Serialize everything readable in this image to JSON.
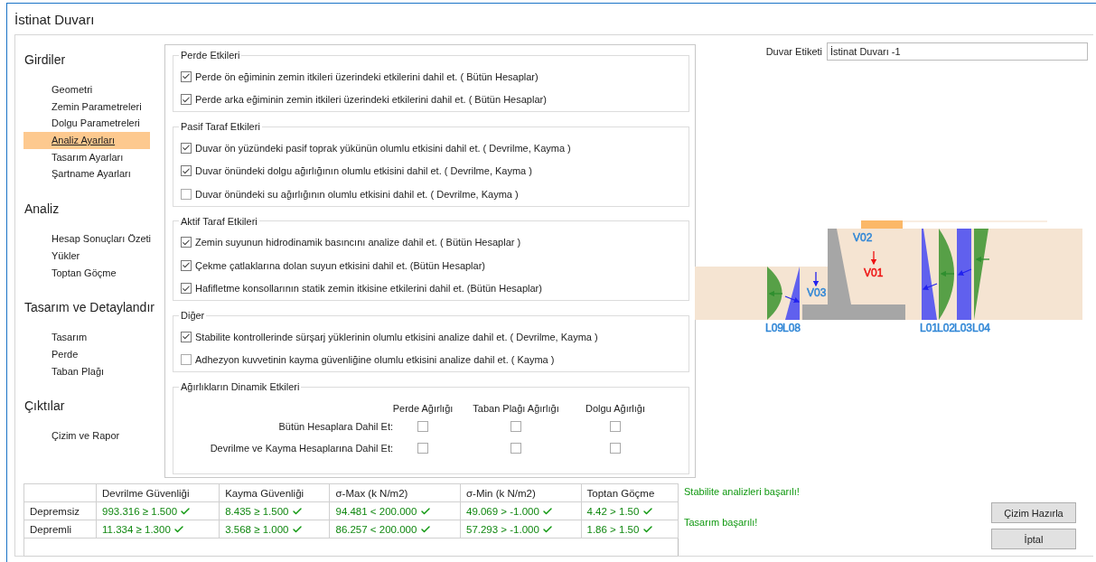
{
  "window": {
    "title": "İstinat Duvarı"
  },
  "sidebar": {
    "sections": [
      {
        "heading": "Girdiler",
        "items": [
          {
            "label": "Geometri",
            "selected": false
          },
          {
            "label": "Zemin Parametreleri",
            "selected": false
          },
          {
            "label": "Dolgu Parametreleri",
            "selected": false
          },
          {
            "label": "Analiz Ayarları",
            "selected": true
          },
          {
            "label": "Tasarım Ayarları",
            "selected": false
          },
          {
            "label": "Şartname Ayarları",
            "selected": false
          }
        ]
      },
      {
        "heading": "Analiz",
        "items": [
          {
            "label": "Hesap Sonuçları Özeti",
            "selected": false
          },
          {
            "label": "Yükler",
            "selected": false
          },
          {
            "label": "Toptan Göçme",
            "selected": false
          }
        ]
      },
      {
        "heading": "Tasarım ve Detaylandır",
        "items": [
          {
            "label": "Tasarım",
            "selected": false
          },
          {
            "label": "Perde",
            "selected": false
          },
          {
            "label": "Taban Plağı",
            "selected": false
          }
        ]
      },
      {
        "heading": "Çıktılar",
        "items": [
          {
            "label": "Çizim ve Rapor",
            "selected": false
          }
        ]
      }
    ]
  },
  "settings": {
    "groups": [
      {
        "legend": "Perde Etkileri",
        "options": [
          {
            "label": "Perde ön eğiminin zemin itkileri üzerindeki etkilerini dahil et. ( Bütün Hesaplar)",
            "checked": true
          },
          {
            "label": "Perde arka eğiminin zemin itkileri üzerindeki etkilerini dahil et. ( Bütün Hesaplar)",
            "checked": true
          }
        ]
      },
      {
        "legend": "Pasif Taraf Etkileri",
        "options": [
          {
            "label": "Duvar ön yüzündeki pasif toprak yükünün olumlu etkisini dahil et. ( Devrilme, Kayma )",
            "checked": true
          },
          {
            "label": "Duvar önündeki dolgu ağırlığının olumlu etkisini dahil et.  ( Devrilme, Kayma )",
            "checked": true
          },
          {
            "label": "Duvar önündeki su ağırlığının olumlu etkisini dahil et. ( Devrilme, Kayma )",
            "checked": false
          }
        ]
      },
      {
        "legend": "Aktif Taraf Etkileri",
        "options": [
          {
            "label": "Zemin suyunun hidrodinamik basıncını analize dahil et. ( Bütün Hesaplar )",
            "checked": true
          },
          {
            "label": "Çekme çatlaklarına dolan suyun etkisini dahil et. (Bütün Hesaplar)",
            "checked": true
          },
          {
            "label": "Hafifletme konsollarının statik zemin itkisine etkilerini dahil et. (Bütün Hesaplar)",
            "checked": true
          }
        ]
      },
      {
        "legend": "Diğer",
        "options": [
          {
            "label": "Stabilite kontrollerinde sürşarj yüklerinin olumlu etkisini analize dahil et. ( Devrilme, Kayma )",
            "checked": true
          },
          {
            "label": "Adhezyon kuvvetinin kayma güvenliğine olumlu etkisini analize dahil et. ( Kayma )",
            "checked": false
          }
        ]
      }
    ],
    "dynamic": {
      "legend": "Ağırlıkların Dinamik Etkileri",
      "columns": [
        "Perde Ağırlığı",
        "Taban Plağı Ağırlığı",
        "Dolgu Ağırlığı"
      ],
      "rows": [
        {
          "label": "Bütün Hesaplara Dahil Et:",
          "checked": [
            false,
            false,
            false
          ]
        },
        {
          "label": "Devrilme ve Kayma Hesaplarına Dahil Et:",
          "checked": [
            false,
            false,
            false
          ]
        }
      ]
    }
  },
  "wall_label": {
    "label": "Duvar Etiketi",
    "value": "İstinat Duvarı -1"
  },
  "diagram": {
    "labels": [
      {
        "text": "V02",
        "color": "#2f86d6"
      },
      {
        "text": "V01",
        "color": "#ee1111"
      },
      {
        "text": "V03",
        "color": "#2f86d6"
      },
      {
        "text": "L09",
        "color": "#2f86d6"
      },
      {
        "text": "L08",
        "color": "#2f86d6"
      },
      {
        "text": "L01",
        "color": "#2f86d6"
      },
      {
        "text": "L02",
        "color": "#2f86d6"
      },
      {
        "text": "L03",
        "color": "#2f86d6"
      },
      {
        "text": "L04",
        "color": "#2f86d6"
      }
    ]
  },
  "results": {
    "columns": [
      "Devrilme Güvenliği",
      "Kayma Güvenliği",
      "σ-Max (k N/m2)",
      "σ-Min (k N/m2)",
      "Toptan Göçme"
    ],
    "rows": [
      {
        "name": "Depremsiz",
        "cells": [
          {
            "text": "993.316 ≥ 1.500",
            "ok": true
          },
          {
            "text": "8.435 ≥ 1.500",
            "ok": true
          },
          {
            "text": "94.481 < 200.000",
            "ok": true
          },
          {
            "text": "49.069 > -1.000",
            "ok": true
          },
          {
            "text": "4.42 > 1.50",
            "ok": true
          }
        ]
      },
      {
        "name": "Depremli",
        "cells": [
          {
            "text": "11.334 ≥ 1.300",
            "ok": true
          },
          {
            "text": "3.568 ≥ 1.000",
            "ok": true
          },
          {
            "text": "86.257 < 200.000",
            "ok": true
          },
          {
            "text": "57.293 > -1.000",
            "ok": true
          },
          {
            "text": "1.86 > 1.50",
            "ok": true
          }
        ]
      }
    ]
  },
  "messages": [
    "Stabilite analizleri başarılı!",
    "Tasarım başarılı!"
  ],
  "buttons": [
    "Çizim Hazırla",
    "İptal"
  ]
}
